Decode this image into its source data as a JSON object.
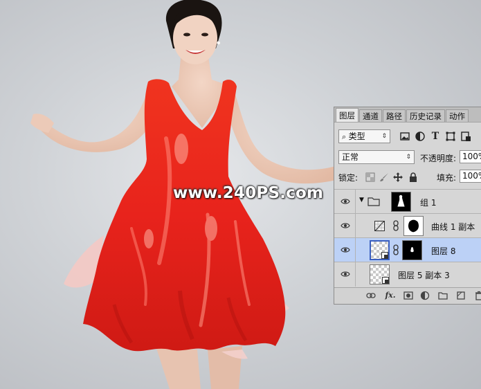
{
  "watermark": "www.240PS.com",
  "panel": {
    "tabs": [
      {
        "label": "图层",
        "active": true
      },
      {
        "label": "通道",
        "active": false
      },
      {
        "label": "路径",
        "active": false
      },
      {
        "label": "历史记录",
        "active": false
      },
      {
        "label": "动作",
        "active": false
      }
    ],
    "filter_kind": "类型",
    "blend_mode": "正常",
    "opacity_label": "不透明度:",
    "opacity_value": "100%",
    "lock_label": "锁定:",
    "fill_label": "填充:",
    "fill_value": "100%",
    "layers": [
      {
        "name": "组 1",
        "type": "group",
        "selected": false
      },
      {
        "name": "曲线 1 副本",
        "type": "adjustment",
        "selected": false
      },
      {
        "name": "图层 8",
        "type": "pixel-mask",
        "selected": true
      },
      {
        "name": "图层 5 副本 3",
        "type": "pixel",
        "selected": false
      }
    ]
  },
  "colors": {
    "dress": "#e8231c",
    "selection": "#bcd1f6",
    "panel_bg": "#d6d6d6"
  }
}
